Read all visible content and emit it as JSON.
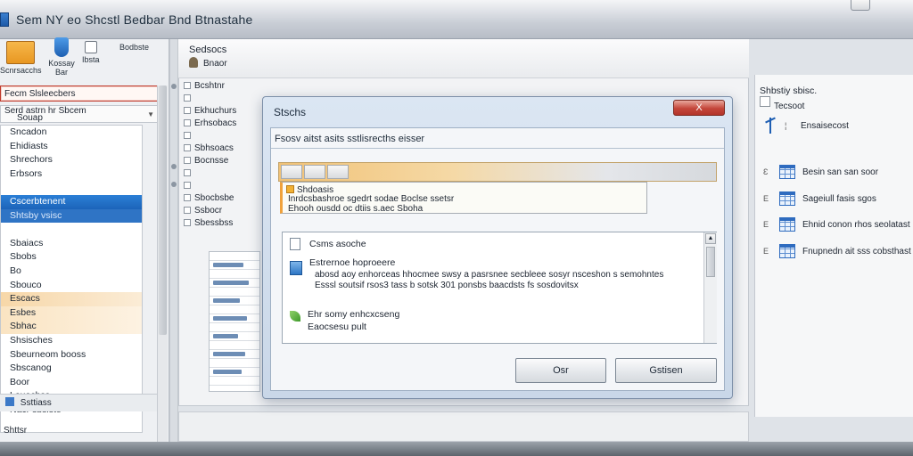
{
  "window": {
    "title": "Sem NY eo Shcstl Bedbar Bnd Btnastahe"
  },
  "left_pane": {
    "ribbon": [
      {
        "label": "Scnrsacchs"
      },
      {
        "label": "Kossay\nBar"
      },
      {
        "label": "Ibsta"
      },
      {
        "label": "Bodbste"
      }
    ],
    "path_value": "Fecm Slsleecbers",
    "filter_line1": "Serd astrn hr Sbcem",
    "filter_line2": "Souap",
    "tree_items": [
      "Sncadon",
      "Ehidiasts",
      "Shrechors",
      "Erbsors",
      "",
      "Cscerbtenent",
      "Shtsby vsisc",
      "",
      "Sbaiacs",
      "Sbobs",
      "Bo",
      "Sbouco",
      "Escacs",
      "Esbes",
      "Sbhac",
      "Shsisches",
      "Sbeurneom booss",
      "Sbscanog",
      "Boor",
      "Louecbss",
      "Nacr sbsiste"
    ],
    "status_label": "Ssttiass",
    "footer_label": "Shttsr"
  },
  "center": {
    "header_title": "Sedsocs",
    "header_sub": "Bnaor",
    "mid_list": [
      "Bcshtnr",
      "",
      "Ekhuchurs",
      "Erhsobacs",
      "",
      "Sbhsoacs",
      "Bocnsse",
      "",
      "",
      "Sbocbsbe",
      "Ssbocr",
      "Sbessbss"
    ]
  },
  "dialog": {
    "title": "Stschs",
    "close_label": "X",
    "caption": "Fsosv aitst asits sstlisrecths eisser",
    "notice_title": "Shdoasis",
    "notice_line1": "Inrdcsbashroe sgedrt sodae Boclse ssetsr",
    "notice_line2": "Ehooh ousdd oc dtiis s.aec Sboha",
    "info_heading": "Csms asoche",
    "info_item_title": "Estrernoe hoproeere",
    "info_item_body1": "abosd aoy enhorceas hhocmee swsy a pasrsnee secbleee sosyr nsceshon s semohntes",
    "info_item_body2": "Esssl soutsif rsos3 tass b sotsk 301 ponsbs baacdsts fs sosdovitsx",
    "info_item2_title": "Ehr somy enhcxcseng",
    "info_item2_sub": "Eaocsesu pult",
    "ok_label": "Osr",
    "cancel_label": "Gstisen"
  },
  "right_pane": {
    "title": "Shbstiy sbisc.",
    "subtitle": "Tecsoot",
    "items": [
      {
        "label": "Ensaisecost",
        "icon": "arrow-icon"
      },
      {
        "label": "Besin san san soor",
        "icon": "grid-icon"
      },
      {
        "label": "Sageiull fasis sgos",
        "icon": "grid-icon"
      },
      {
        "label": "Ehnid conon rhos seolatast",
        "icon": "grid-icon"
      },
      {
        "label": "Fnupnedn ait sss cobsthast",
        "icon": "grid-icon"
      }
    ]
  }
}
